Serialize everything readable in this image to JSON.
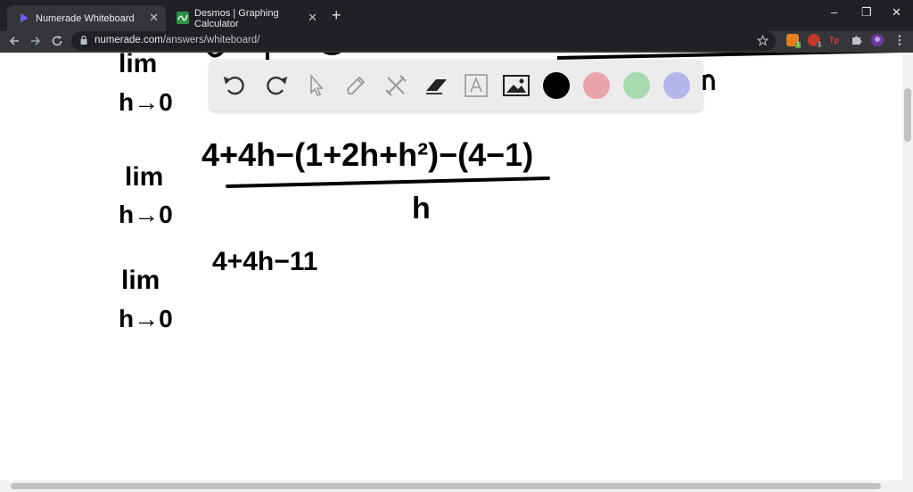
{
  "browser": {
    "tabs": [
      {
        "title": "Numerade Whiteboard",
        "active": true,
        "close": "✕"
      },
      {
        "title": "Desmos | Graphing Calculator",
        "active": false,
        "close": "✕"
      }
    ],
    "new_tab": "+",
    "window_controls": [
      "–",
      "❐",
      "✕"
    ],
    "url_host": "numerade.com",
    "url_path": "/answers/whiteboard/",
    "nav_icons": [
      "back-arrow-icon",
      "forward-arrow-icon",
      "reload-icon"
    ],
    "extensions": [
      {
        "badge": "1",
        "color": "#e67e22"
      },
      {
        "badge": "1",
        "color": "#c0392b"
      },
      {
        "badge": "Tp",
        "color": "#202124"
      },
      {
        "icon": "puzzle-icon"
      },
      {
        "icon": "avatar"
      },
      {
        "icon": "kebab-menu-icon"
      }
    ]
  },
  "whiteboard": {
    "tools": [
      "undo-icon",
      "redo-icon",
      "select-pointer-icon",
      "pen-icon",
      "tools-icon",
      "eraser-icon",
      "text-box-icon",
      "image-icon"
    ],
    "colors": [
      "#000000",
      "#eaa4ac",
      "#a9d9b0",
      "#b7b6ec"
    ],
    "handwriting": {
      "line1_lim": "lim",
      "line1_h": "h→0",
      "line2_lim": "lim",
      "line2_h": "h→0",
      "line2_num": "4+4h−(1+2h+h²)−(4−1)",
      "line2_den": "h",
      "line3_lim": "lim",
      "line3_h": "h→0",
      "line3_num": "4+4h−11"
    }
  }
}
